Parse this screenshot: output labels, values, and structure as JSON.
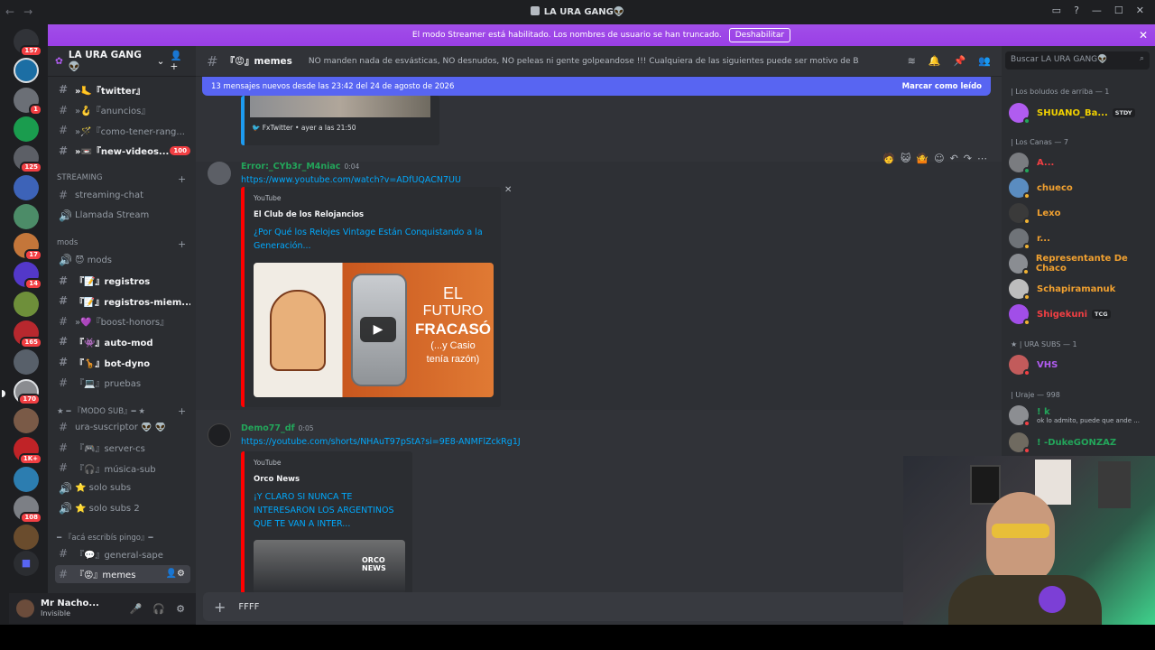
{
  "window": {
    "title": "LA URA GANG👽"
  },
  "banner": {
    "text": "El modo Streamer está habilitado. Los nombres de usuario se han truncado.",
    "button": "Deshabilitar"
  },
  "servers": [
    {
      "badge": "157",
      "color": "#313338"
    },
    {
      "badge": "",
      "color": "#1c6ea4"
    },
    {
      "badge": "1",
      "color": "#6b6f76"
    },
    {
      "badge": "",
      "color": "#1a9c4e"
    },
    {
      "badge": "125",
      "color": "#5c5f66"
    },
    {
      "badge": "",
      "color": "#3d63b8"
    },
    {
      "badge": "",
      "color": "#4c8c68"
    },
    {
      "badge": "17",
      "color": "#c4763a"
    },
    {
      "badge": "14",
      "color": "#5338c9"
    },
    {
      "badge": "",
      "color": "#6e8f3a"
    },
    {
      "badge": "165",
      "color": "#b7282e"
    },
    {
      "badge": "",
      "color": "#58606a"
    },
    {
      "badge": "170",
      "color": "#8a8c90"
    },
    {
      "badge": "",
      "color": "#7a5a47"
    },
    {
      "badge": "1K+",
      "color": "#c02327"
    },
    {
      "badge": "",
      "color": "#2c7db0"
    },
    {
      "badge": "108",
      "color": "#7c7f85"
    },
    {
      "badge": "",
      "color": "#6a4c2d"
    }
  ],
  "guild": {
    "name": "LA URA GANG 👽"
  },
  "channels": [
    {
      "name": "»🦶『twitter』",
      "unread": true,
      "badge": "",
      "icon": "#"
    },
    {
      "name": "»🪝『anuncios』",
      "unread": false,
      "badge": "",
      "icon": "#"
    },
    {
      "name": "»🪄『como-tener-rang...",
      "unread": false,
      "badge": "",
      "icon": "#"
    },
    {
      "name": "»📼『new-videos...",
      "unread": true,
      "badge": "100",
      "icon": "#"
    }
  ],
  "cat_streaming": "STREAMING",
  "streaming": [
    {
      "name": "streaming-chat",
      "icon": "#"
    },
    {
      "name": "Llamada Stream",
      "icon": "🔊"
    }
  ],
  "cat_mods": "mods",
  "mods": [
    {
      "name": "😈 mods",
      "unread": false,
      "icon": "🔊"
    },
    {
      "name": "『📝』registros",
      "unread": true,
      "icon": "#"
    },
    {
      "name": "『📝』registros-miem...",
      "unread": true,
      "icon": "#"
    },
    {
      "name": "»💜『boost-honors』",
      "unread": false,
      "icon": "#"
    },
    {
      "name": "『👾』auto-mod",
      "unread": true,
      "icon": "#"
    },
    {
      "name": "『🦒』bot-dyno",
      "unread": true,
      "icon": "#"
    },
    {
      "name": "『💻』pruebas",
      "unread": false,
      "icon": "#"
    }
  ],
  "cat_sub": "★ ━ 『MODO SUB』━ ★",
  "sub": [
    {
      "name": "ura-suscriptor 👽 👽",
      "icon": "#"
    },
    {
      "name": "『🎮』server-cs",
      "icon": "#"
    },
    {
      "name": "『🎧』música-sub",
      "icon": "#"
    },
    {
      "name": "⭐ solo subs",
      "icon": "🔊"
    },
    {
      "name": "⭐ solo subs 2",
      "icon": "🔊"
    }
  ],
  "cat_pingo": "━ 『acá escribís pingo』━",
  "pingo": [
    {
      "name": "『💬』general-sape",
      "icon": "#"
    },
    {
      "name": "『😡』memes",
      "icon": "#"
    }
  ],
  "user": {
    "name": "Mr Nacho...",
    "status": "Invisible"
  },
  "channel_header": {
    "name": "『😡』memes",
    "topic": "NO manden nada de esvásticas, NO desnudos, NO peleas ni gente golpeandose !!! Cualquiera de las siguientes puede ser motivo de BAN, cuiden el stream!"
  },
  "newbar": {
    "text": "13 mensajes nuevos desde las 23:42 del 24 de agosto de 2026",
    "action": "Marcar como leído"
  },
  "fx": {
    "name": "FxTwitter",
    "time": "ayer a las 21:50"
  },
  "messages": [
    {
      "user": "Error:_CYb3r_M4niac",
      "time": "0:04",
      "link": "https://www.youtube.com/watch?v=ADfUQACN7UU",
      "provider": "YouTube",
      "author": "El Club de los Relojancios",
      "title": "¿Por Qué los Relojes Vintage Están Conquistando a la Generación...",
      "thumb_text1": "EL",
      "thumb_text2": "FUTURO",
      "thumb_text3": "FRACASÓ",
      "thumb_text4": "(...y Casio",
      "thumb_text5": "tenía razón)"
    },
    {
      "user": "Demo77_df",
      "time": "0:05",
      "link": "https://youtube.com/shorts/NHAuT97pStA?si=9E8-ANMFlZckRg1J",
      "provider": "YouTube",
      "author": "Orco News",
      "title": "¡Y CLARO SI NUNCA TE INTERESARON LOS ARGENTINOS QUE TE VAN A INTER...",
      "thumb_text": "ORCO NEWS"
    }
  ],
  "composer": {
    "value": "FFFF"
  },
  "members_search": "Buscar LA URA GANG👽",
  "member_groups": [
    {
      "title": "| Los boludos de arriba — 1",
      "members": [
        {
          "name": "SHUANO_Ba...",
          "tag": "STDY",
          "color": "#f0d000"
        }
      ]
    },
    {
      "title": "| Los Canas — 7",
      "members": [
        {
          "name": "A...",
          "tag": "",
          "color": "#f23f43"
        },
        {
          "name": "chueco",
          "tag": "",
          "color": "#f0a030"
        },
        {
          "name": "Lexo",
          "tag": "",
          "color": "#f0a030"
        },
        {
          "name": "r...",
          "tag": "",
          "color": "#f0a030"
        },
        {
          "name": "Representante De Chaco",
          "tag": "",
          "color": "#f0a030"
        },
        {
          "name": "Schapiramanuk",
          "tag": "",
          "color": "#f0a030"
        },
        {
          "name": "Shigekuni",
          "tag": "TCG",
          "color": "#f23f43"
        }
      ]
    },
    {
      "title": "★ | URA SUBS — 1",
      "members": [
        {
          "name": "VHS",
          "tag": "",
          "color": "#b05cf0"
        }
      ]
    },
    {
      "title": "| Uraje — 998",
      "members": [
        {
          "name": "! k",
          "tag": "",
          "color": "#23a55a",
          "sub": "ok lo admito, puede que ande ..."
        },
        {
          "name": "! -DukeGONZAZ",
          "tag": "",
          "color": "#23a55a",
          "sub": ""
        }
      ]
    }
  ]
}
